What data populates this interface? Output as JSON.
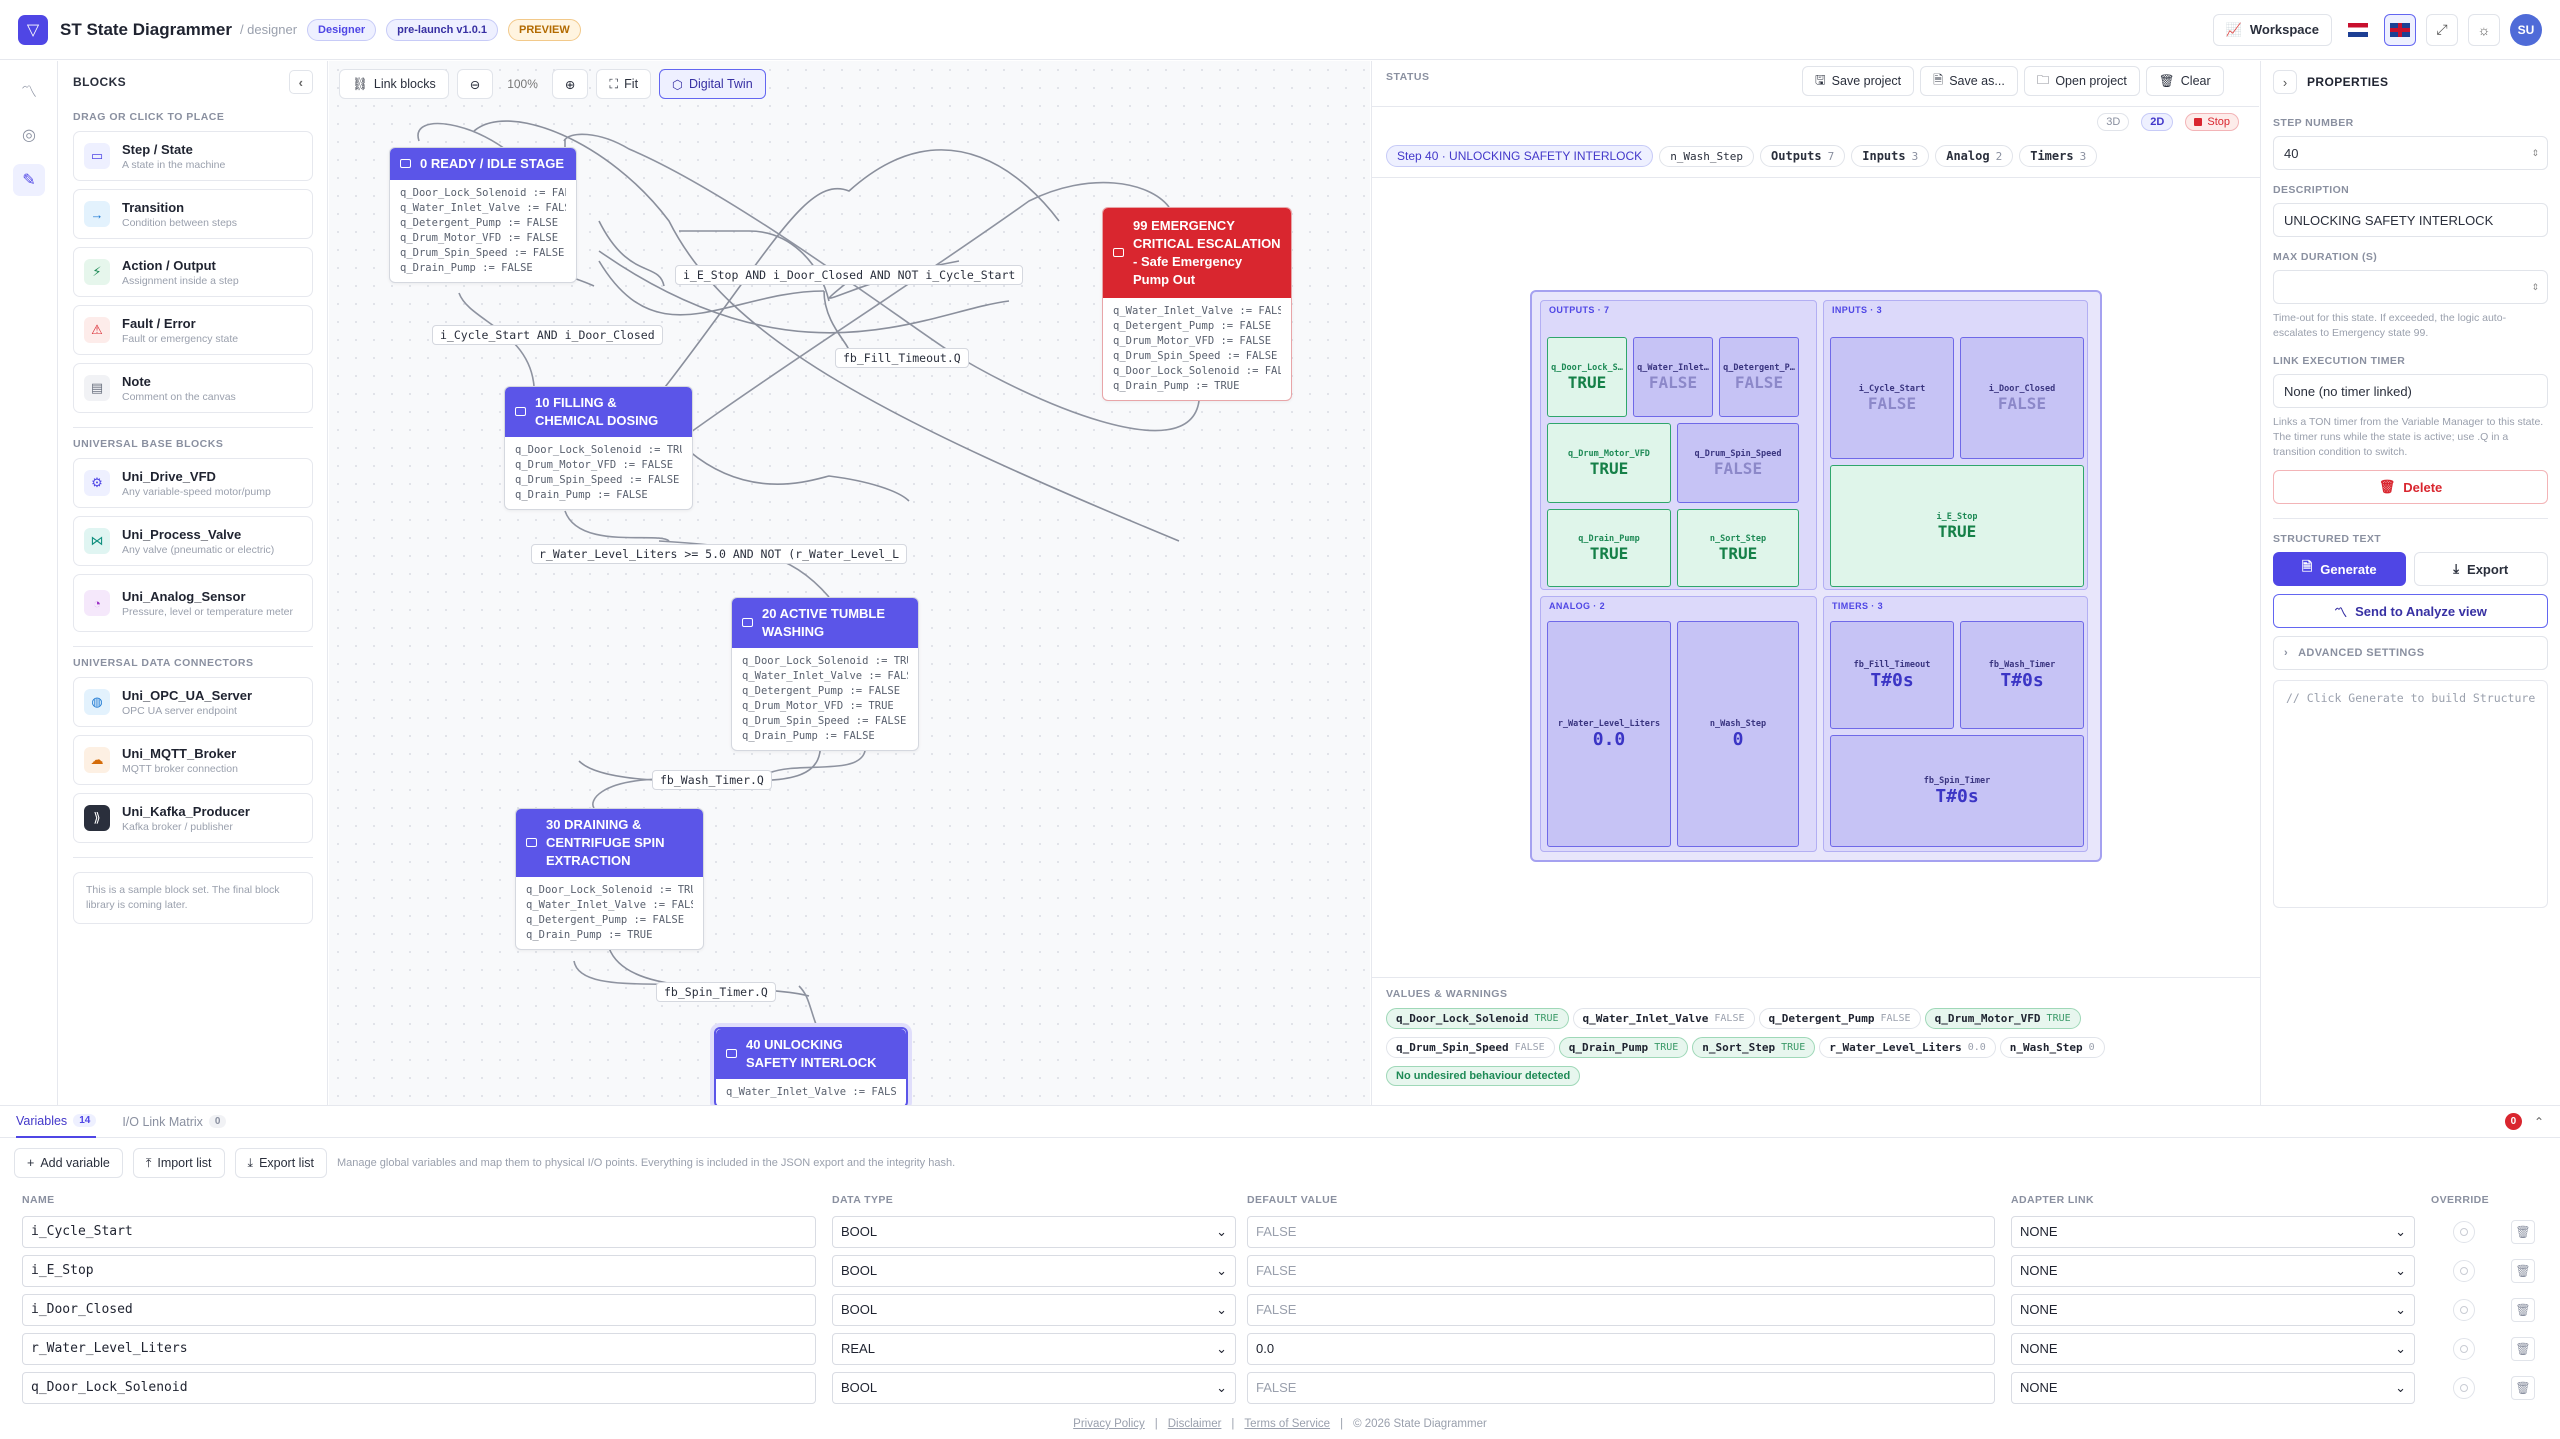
{
  "header": {
    "app_title": "ST State Diagrammer",
    "app_sub": "/ designer",
    "badge_role": "Designer",
    "badge_version": "pre-launch v1.0.1",
    "badge_preview": "PREVIEW",
    "workspace_label": "Workspace",
    "avatar_initials": "SU",
    "brand_color": "#4f46e5"
  },
  "blocks": {
    "title": "BLOCKS",
    "section_place": "DRAG OR CLICK TO PLACE",
    "section_universal": "UNIVERSAL BASE BLOCKS",
    "section_connectors": "UNIVERSAL DATA CONNECTORS",
    "items": [
      {
        "title": "Step / State",
        "sub": "A state in the machine",
        "icon": "state-icon"
      },
      {
        "title": "Transition",
        "sub": "Condition between steps",
        "icon": "arrow-right-icon"
      },
      {
        "title": "Action / Output",
        "sub": "Assignment inside a step",
        "icon": "lightning-icon"
      },
      {
        "title": "Fault / Error",
        "sub": "Fault or emergency state",
        "icon": "warning-icon"
      },
      {
        "title": "Note",
        "sub": "Comment on the canvas",
        "icon": "note-icon"
      }
    ],
    "universal": [
      {
        "title": "Uni_Drive_VFD",
        "sub": "Any variable-speed motor/pump",
        "icon": "drive-icon"
      },
      {
        "title": "Uni_Process_Valve",
        "sub": "Any valve (pneumatic or electric)",
        "icon": "valve-icon"
      },
      {
        "title": "Uni_Analog_Sensor",
        "sub": "Pressure, level or temperature meter",
        "icon": "gauge-icon"
      }
    ],
    "connectors": [
      {
        "title": "Uni_OPC_UA_Server",
        "sub": "OPC UA server endpoint",
        "icon": "server-icon"
      },
      {
        "title": "Uni_MQTT_Broker",
        "sub": "MQTT broker connection",
        "icon": "broker-icon"
      },
      {
        "title": "Uni_Kafka_Producer",
        "sub": "Kafka broker / publisher",
        "icon": "kafka-icon"
      }
    ],
    "note": "This is a sample block set. The final block library is coming later."
  },
  "canvas": {
    "link_blocks": "Link blocks",
    "zoom": "100%",
    "fit": "Fit",
    "digital_twin": "Digital Twin",
    "nodes": {
      "n0": {
        "title": "0 READY / IDLE STAGE",
        "lines": [
          "q_Door_Lock_Solenoid := FAL…",
          "q_Water_Inlet_Valve := FALSE",
          "q_Detergent_Pump := FALSE",
          "q_Drum_Motor_VFD := FALSE",
          "q_Drum_Spin_Speed := FALSE",
          "q_Drain_Pump := FALSE"
        ]
      },
      "n10": {
        "title": "10 FILLING & CHEMICAL DOSING",
        "lines": [
          "q_Door_Lock_Solenoid := TRUE",
          "q_Drum_Motor_VFD := FALSE",
          "q_Drum_Spin_Speed := FALSE",
          "q_Drain_Pump := FALSE"
        ]
      },
      "n20": {
        "title": "20 ACTIVE TUMBLE WASHING",
        "lines": [
          "q_Door_Lock_Solenoid := TRUE",
          "q_Water_Inlet_Valve := FALSE",
          "q_Detergent_Pump := FALSE",
          "q_Drum_Motor_VFD := TRUE",
          "q_Drum_Spin_Speed := FALSE",
          "q_Drain_Pump := FALSE"
        ]
      },
      "n30": {
        "title": "30 DRAINING & CENTRIFUGE SPIN EXTRACTION",
        "lines": [
          "q_Door_Lock_Solenoid := TRUE",
          "q_Water_Inlet_Valve := FALSE",
          "q_Detergent_Pump := FALSE",
          "q_Drain_Pump := TRUE"
        ]
      },
      "n40": {
        "title": "40 UNLOCKING SAFETY INTERLOCK",
        "lines": [
          "q_Water_Inlet_Valve := FALSE"
        ]
      },
      "n99": {
        "title": "99 EMERGENCY CRITICAL ESCALATION - Safe Emergency Pump Out",
        "lines": [
          "q_Water_Inlet_Valve := FALSE",
          "q_Detergent_Pump := FALSE",
          "q_Drum_Motor_VFD := FALSE",
          "q_Drum_Spin_Speed := FALSE",
          "q_Door_Lock_Solenoid := FAL…",
          "q_Drain_Pump := TRUE"
        ]
      }
    },
    "transitions": {
      "t_estop": "i_E_Stop AND i_Door_Closed AND NOT i_Cycle_Start",
      "t_start": "i_Cycle_Start AND i_Door_Closed",
      "t_fill": "fb_Fill_Timeout.Q",
      "t_level": "r_Water_Level_Liters >= 5.0 AND NOT (r_Water_Level_L",
      "t_wash": "fb_Wash_Timer.Q",
      "t_spin": "fb_Spin_Timer.Q"
    }
  },
  "status": {
    "label": "STATUS",
    "btn_3d": "3D",
    "btn_2d": "2D",
    "btn_stop": "Stop",
    "save_project": "Save project",
    "save_as": "Save as...",
    "open_project": "Open project",
    "clear": "Clear",
    "step_chip": "Step 40 · UNLOCKING SAFETY INTERLOCK",
    "wash_step_chip": "n_Wash_Step",
    "counts": [
      {
        "label": "Outputs",
        "n": "7"
      },
      {
        "label": "Inputs",
        "n": "3"
      },
      {
        "label": "Analog",
        "n": "2"
      },
      {
        "label": "Timers",
        "n": "3"
      }
    ],
    "twin": {
      "outputs_label": "OUTPUTS · 7",
      "inputs_label": "INPUTS · 3",
      "analog_label": "ANALOG · 2",
      "timers_label": "TIMERS · 3",
      "outputs": [
        {
          "name": "q_Door_Lock_S…",
          "value": "TRUE",
          "on": true
        },
        {
          "name": "q_Water_Inlet…",
          "value": "FALSE",
          "on": false
        },
        {
          "name": "q_Detergent_P…",
          "value": "FALSE",
          "on": false
        },
        {
          "name": "q_Drum_Motor_VFD",
          "value": "TRUE",
          "on": true
        },
        {
          "name": "q_Drum_Spin_Speed",
          "value": "FALSE",
          "on": false
        },
        {
          "name": "q_Drain_Pump",
          "value": "TRUE",
          "on": true
        },
        {
          "name": "n_Sort_Step",
          "value": "TRUE",
          "on": true
        }
      ],
      "inputs": [
        {
          "name": "i_Cycle_Start",
          "value": "FALSE",
          "on": false
        },
        {
          "name": "i_Door_Closed",
          "value": "FALSE",
          "on": false
        },
        {
          "name": "i_E_Stop",
          "value": "TRUE",
          "on": true
        }
      ],
      "analog": [
        {
          "name": "r_Water_Level_Liters",
          "value": "0.0"
        },
        {
          "name": "n_Wash_Step",
          "value": "0"
        }
      ],
      "timers": [
        {
          "name": "fb_Fill_Timeout",
          "value": "T#0s"
        },
        {
          "name": "fb_Wash_Timer",
          "value": "T#0s"
        },
        {
          "name": "fb_Spin_Timer",
          "value": "T#0s"
        }
      ]
    },
    "values_label": "VALUES & WARNINGS",
    "values": [
      {
        "name": "q_Door_Lock_Solenoid",
        "value": "TRUE",
        "on": true
      },
      {
        "name": "q_Water_Inlet_Valve",
        "value": "FALSE",
        "on": false
      },
      {
        "name": "q_Detergent_Pump",
        "value": "FALSE",
        "on": false
      },
      {
        "name": "q_Drum_Motor_VFD",
        "value": "TRUE",
        "on": true
      },
      {
        "name": "q_Drum_Spin_Speed",
        "value": "FALSE",
        "on": false
      },
      {
        "name": "q_Drain_Pump",
        "value": "TRUE",
        "on": true
      },
      {
        "name": "n_Sort_Step",
        "value": "TRUE",
        "on": true
      },
      {
        "name": "r_Water_Level_Liters",
        "value": "0.0",
        "on": false
      },
      {
        "name": "n_Wash_Step",
        "value": "0",
        "on": false
      }
    ],
    "ok_badge": "No undesired behaviour detected"
  },
  "properties": {
    "title": "PROPERTIES",
    "step_number_label": "STEP NUMBER",
    "step_number": "40",
    "description_label": "DESCRIPTION",
    "description": "UNLOCKING SAFETY INTERLOCK",
    "max_duration_label": "MAX DURATION (S)",
    "max_duration_help": "Time-out for this state. If exceeded, the logic auto-escalates to Emergency state 99.",
    "timer_label": "LINK EXECUTION TIMER",
    "timer_value": "None (no timer linked)",
    "timer_help": "Links a TON timer from the Variable Manager to this state. The timer runs while the state is active; use .Q in a transition condition to switch.",
    "delete": "Delete",
    "structured_text_label": "STRUCTURED TEXT",
    "generate": "Generate",
    "export": "Export",
    "send_analyze": "Send to Analyze view",
    "advanced": "ADVANCED SETTINGS",
    "code_placeholder": "// Click Generate to build Structure"
  },
  "variables": {
    "tab_variables": "Variables",
    "tab_variables_count": "14",
    "tab_io": "I/O Link Matrix",
    "tab_io_count": "0",
    "error_count": "0",
    "add_variable": "Add variable",
    "import_list": "Import list",
    "export_list": "Export list",
    "help": "Manage global variables and map them to physical I/O points. Everything is included in the JSON export and the integrity hash.",
    "columns": [
      "NAME",
      "DATA TYPE",
      "DEFAULT VALUE",
      "ADAPTER LINK",
      "OVERRIDE"
    ],
    "rows": [
      {
        "name": "i_Cycle_Start",
        "type": "BOOL",
        "default": "FALSE",
        "placeholder": true,
        "adapter": "NONE"
      },
      {
        "name": "i_E_Stop",
        "type": "BOOL",
        "default": "FALSE",
        "placeholder": true,
        "adapter": "NONE"
      },
      {
        "name": "i_Door_Closed",
        "type": "BOOL",
        "default": "FALSE",
        "placeholder": true,
        "adapter": "NONE"
      },
      {
        "name": "r_Water_Level_Liters",
        "type": "REAL",
        "default": "0.0",
        "placeholder": false,
        "adapter": "NONE"
      },
      {
        "name": "q_Door_Lock_Solenoid",
        "type": "BOOL",
        "default": "FALSE",
        "placeholder": true,
        "adapter": "NONE"
      }
    ]
  },
  "footer": {
    "privacy": "Privacy Policy",
    "disclaimer": "Disclaimer",
    "terms": "Terms of Service",
    "copyright": "© 2026 State Diagrammer"
  }
}
